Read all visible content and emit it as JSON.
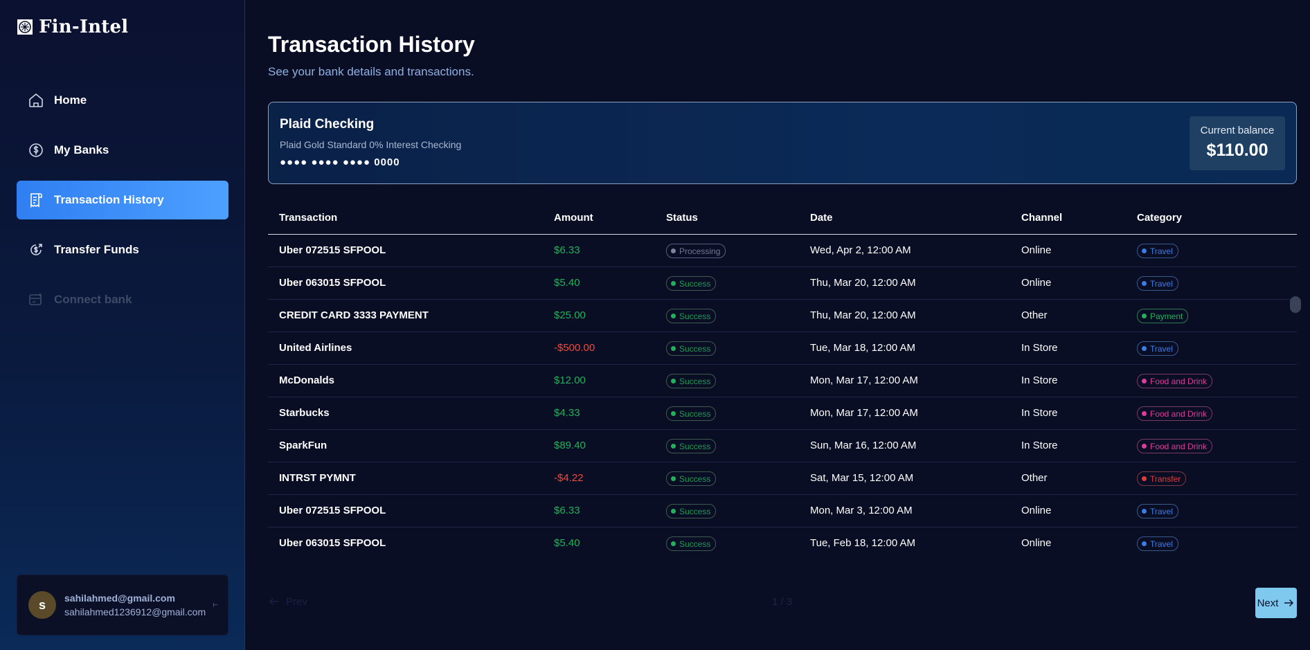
{
  "brand": {
    "name": "Fin-Intel"
  },
  "sidebar": {
    "items": [
      {
        "label": "Home",
        "icon": "home-icon"
      },
      {
        "label": "My Banks",
        "icon": "dollar-circle-icon"
      },
      {
        "label": "Transaction History",
        "icon": "receipt-icon"
      },
      {
        "label": "Transfer Funds",
        "icon": "money-send-icon"
      },
      {
        "label": "Connect bank",
        "icon": "card-plus-icon"
      }
    ],
    "active": "Transaction History"
  },
  "user": {
    "initial": "s",
    "name": "sahilahmed@gmail.com",
    "email": "sahilahmed1236912@gmail.com"
  },
  "header": {
    "title": "Transaction History",
    "subtitle": "See your bank details and transactions."
  },
  "bank": {
    "name": "Plaid Checking",
    "official_name": "Plaid Gold Standard 0% Interest Checking",
    "mask": "●●●● ●●●● ●●●● 0000",
    "balance_label": "Current balance",
    "balance": "$110.00"
  },
  "table": {
    "headers": [
      "Transaction",
      "Amount",
      "Status",
      "Date",
      "Channel",
      "Category"
    ],
    "rows": [
      {
        "name": "Uber 072515 SFPOOL",
        "amount": "$6.33",
        "status": "Processing",
        "date": "Wed, Apr 2, 12:00 AM",
        "channel": "Online",
        "category": "Travel"
      },
      {
        "name": "Uber 063015 SFPOOL",
        "amount": "$5.40",
        "status": "Success",
        "date": "Thu, Mar 20, 12:00 AM",
        "channel": "Online",
        "category": "Travel"
      },
      {
        "name": "CREDIT CARD 3333 PAYMENT",
        "amount": "$25.00",
        "status": "Success",
        "date": "Thu, Mar 20, 12:00 AM",
        "channel": "Other",
        "category": "Payment"
      },
      {
        "name": "United Airlines",
        "amount": "-$500.00",
        "status": "Success",
        "date": "Tue, Mar 18, 12:00 AM",
        "channel": "In Store",
        "category": "Travel"
      },
      {
        "name": "McDonalds",
        "amount": "$12.00",
        "status": "Success",
        "date": "Mon, Mar 17, 12:00 AM",
        "channel": "In Store",
        "category": "Food and Drink"
      },
      {
        "name": "Starbucks",
        "amount": "$4.33",
        "status": "Success",
        "date": "Mon, Mar 17, 12:00 AM",
        "channel": "In Store",
        "category": "Food and Drink"
      },
      {
        "name": "SparkFun",
        "amount": "$89.40",
        "status": "Success",
        "date": "Sun, Mar 16, 12:00 AM",
        "channel": "In Store",
        "category": "Food and Drink"
      },
      {
        "name": "INTRST PYMNT",
        "amount": "-$4.22",
        "status": "Success",
        "date": "Sat, Mar 15, 12:00 AM",
        "channel": "Other",
        "category": "Transfer"
      },
      {
        "name": "Uber 072515 SFPOOL",
        "amount": "$6.33",
        "status": "Success",
        "date": "Mon, Mar 3, 12:00 AM",
        "channel": "Online",
        "category": "Travel"
      },
      {
        "name": "Uber 063015 SFPOOL",
        "amount": "$5.40",
        "status": "Success",
        "date": "Tue, Feb 18, 12:00 AM",
        "channel": "Online",
        "category": "Travel"
      }
    ]
  },
  "pagination": {
    "prev_label": "Prev",
    "page_text": "1 / 3",
    "next_label": "Next"
  }
}
